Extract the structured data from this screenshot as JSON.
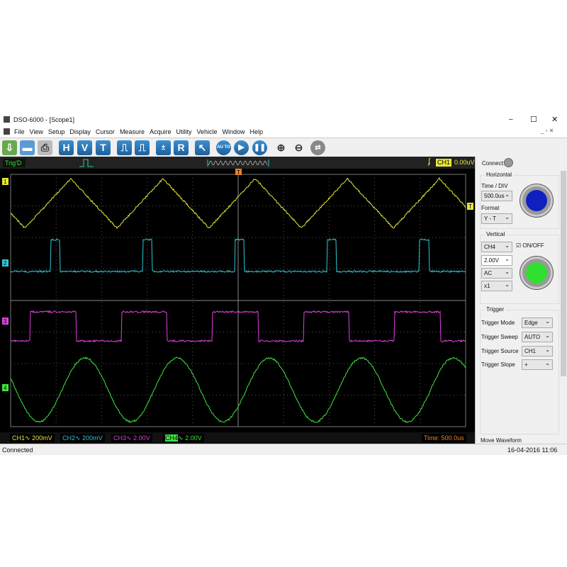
{
  "window": {
    "title": "DSO-6000 - [Scope1]",
    "minimize": "–",
    "maximize": "☐",
    "close": "✕"
  },
  "menu": [
    "File",
    "View",
    "Setup",
    "Display",
    "Cursor",
    "Measure",
    "Acquire",
    "Utility",
    "Vehicle",
    "Window",
    "Help"
  ],
  "toolbar": {
    "h": "H",
    "v": "V",
    "t": "T",
    "r": "R",
    "auto": "AU TO"
  },
  "status_strip": {
    "trig_state": "Trig'D",
    "trigger_channel": "CH1",
    "trigger_level": "0.00uV"
  },
  "channels": [
    {
      "label": "CH1",
      "coupling": "∿",
      "scale": "200mV",
      "color": "#e8e83a",
      "marker": "1"
    },
    {
      "label": "CH2",
      "coupling": "∿",
      "scale": "200mV",
      "color": "#2ec8d8",
      "marker": "2"
    },
    {
      "label": "CH3",
      "coupling": "∿",
      "scale": "2.00V",
      "color": "#e040e0",
      "marker": "3"
    },
    {
      "label": "CH4",
      "coupling": "∿",
      "scale": "2.00V",
      "color": "#3de83d",
      "marker": "4"
    }
  ],
  "time_readout": "Time: 500.0us",
  "trigger_marker": "T",
  "statusbar": {
    "left": "Connected",
    "right": "16-04-2016  11:06"
  },
  "panel": {
    "connect": "Connect:",
    "horizontal": {
      "title": "Horizontal",
      "time_div_label": "Time / DIV",
      "time_div": "500.0us",
      "format_label": "Format",
      "format": "Y - T"
    },
    "vertical": {
      "title": "Vertical",
      "channel": "CH4",
      "onoff": "ON/OFF",
      "onoff_checked": true,
      "volts": "2.00V",
      "coupling": "AC",
      "probe": "x1"
    },
    "trigger": {
      "title": "Trigger",
      "mode_label": "Trigger Mode",
      "mode": "Edge",
      "sweep_label": "Trigger Sweep",
      "sweep": "AUTO",
      "source_label": "Trigger Source",
      "source": "CH1",
      "slope_label": "Trigger Slope",
      "slope": "+"
    },
    "move_waveform": "Move Waveform"
  }
}
